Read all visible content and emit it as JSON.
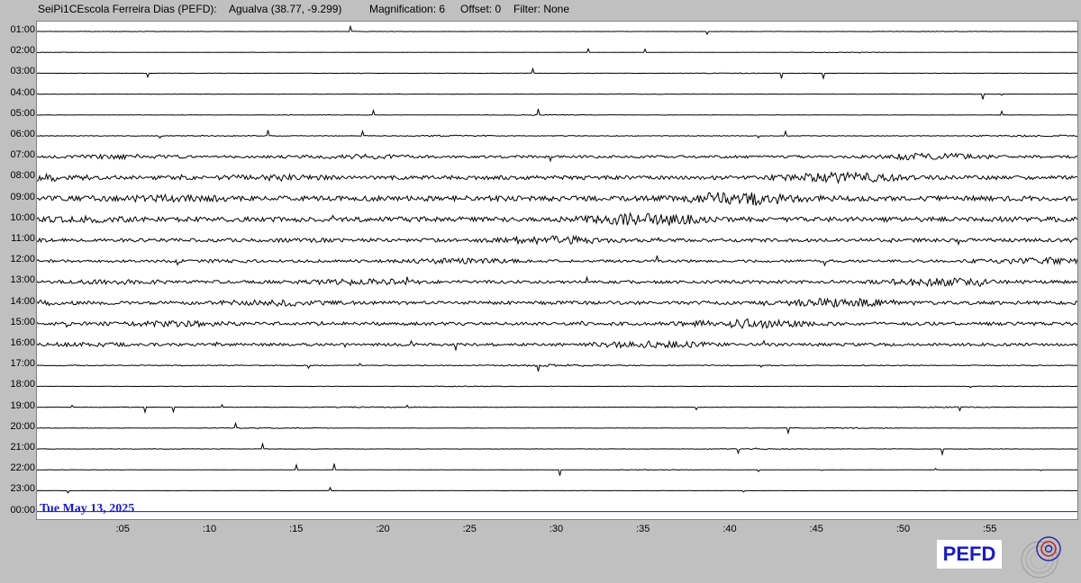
{
  "header": {
    "station": "SeiPi1CEscola Ferreira Dias (PEFD):",
    "location": "Agualva (38.77, -9.299)",
    "magnification": "Magnification: 6",
    "offset": "Offset: 0",
    "filter": "Filter: None"
  },
  "date_label": "Tue May 13, 2025",
  "logo_text": "PEFD",
  "colors": {
    "background": "#c0c0c0",
    "trace": "#000000",
    "current_line": "#1a1ad0",
    "date": "#1a1ad0",
    "logo": "#1a1ad0"
  },
  "chart_data": {
    "type": "line",
    "title": "",
    "xlabel": "",
    "ylabel": "",
    "grid": false,
    "x_ticks": [
      ":05",
      ":10",
      ":15",
      ":20",
      ":25",
      ":30",
      ":35",
      ":40",
      ":45",
      ":50",
      ":55"
    ],
    "x_tick_minutes": [
      5,
      10,
      15,
      20,
      25,
      30,
      35,
      40,
      45,
      50,
      55
    ],
    "xlim": [
      0,
      60
    ],
    "rows": [
      "01:00",
      "02:00",
      "03:00",
      "04:00",
      "05:00",
      "06:00",
      "07:00",
      "08:00",
      "09:00",
      "10:00",
      "11:00",
      "12:00",
      "13:00",
      "14:00",
      "15:00",
      "16:00",
      "17:00",
      "18:00",
      "19:00",
      "20:00",
      "21:00",
      "22:00",
      "23:00",
      "00:00"
    ],
    "activity_level": [
      0.04,
      0.04,
      0.05,
      0.04,
      0.06,
      0.12,
      0.45,
      0.7,
      0.9,
      0.85,
      0.6,
      0.45,
      0.55,
      0.6,
      0.6,
      0.5,
      0.15,
      0.06,
      0.08,
      0.07,
      0.06,
      0.04,
      0.03,
      0.0
    ],
    "current_row": "00:00"
  }
}
